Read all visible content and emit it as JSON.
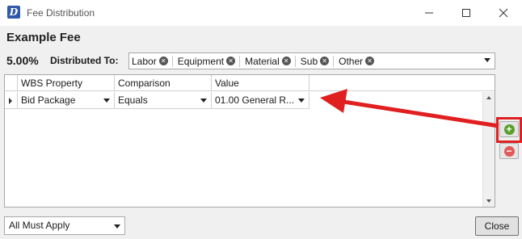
{
  "window": {
    "title": "Fee Distribution",
    "icon_letter": "D"
  },
  "fee": {
    "name": "Example Fee",
    "percent": "5.00%",
    "distributed_label": "Distributed To:",
    "distributed_to": [
      "Labor",
      "Equipment",
      "Material",
      "Sub",
      "Other"
    ]
  },
  "grid": {
    "columns": [
      "WBS Property",
      "Comparison",
      "Value"
    ],
    "rows": [
      {
        "wbs_property": "Bid Package",
        "comparison": "Equals",
        "value": "01.00 General R..."
      }
    ]
  },
  "buttons": {
    "add_icon": "plus-circle-icon",
    "remove_icon": "minus-circle-icon",
    "close_label": "Close"
  },
  "footer": {
    "apply_mode": "All Must Apply"
  },
  "annotation": {
    "color": "#e02020"
  }
}
